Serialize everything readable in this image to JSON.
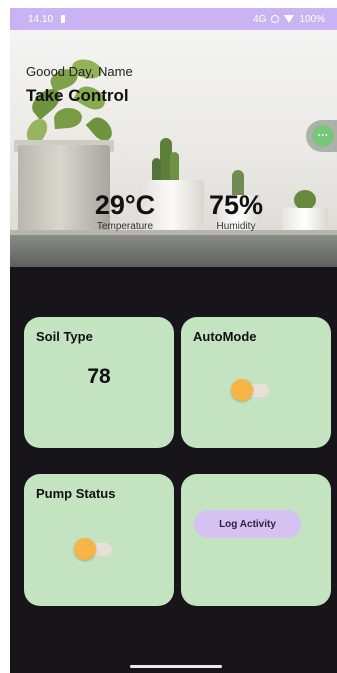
{
  "status_bar": {
    "time": "14.10",
    "network": "4G",
    "battery": "100%"
  },
  "header": {
    "greeting": "Goood Day, Name",
    "title": "Take Control"
  },
  "readings": {
    "temperature": {
      "value": "29°C",
      "label": "Temperature"
    },
    "humidity": {
      "value": "75%",
      "label": "Humidity"
    }
  },
  "fab": {
    "icon": "more-horizontal-icon",
    "label": "···"
  },
  "cards": {
    "soil": {
      "title": "Soil Type",
      "value": "78"
    },
    "automode": {
      "title": "AutoMode",
      "enabled": true
    },
    "pump": {
      "title": "Pump Status",
      "enabled": true
    },
    "log": {
      "button_label": "Log Activity"
    }
  },
  "colors": {
    "status_bar": "#c9b3f2",
    "background": "#17141a",
    "card": "#c4e3c0",
    "toggle_thumb": "#f8b545",
    "button": "#d6c2f2",
    "fab": "#77c77b"
  }
}
